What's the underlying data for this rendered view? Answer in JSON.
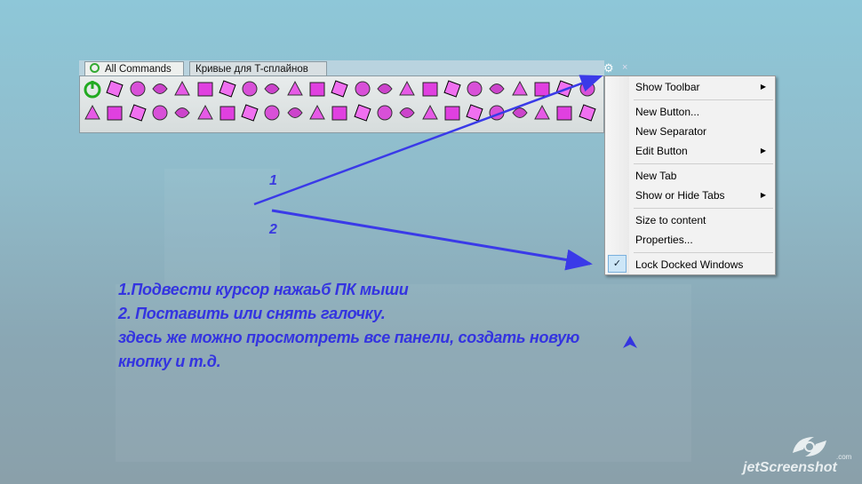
{
  "toolbar": {
    "tabs": [
      {
        "label": "All Commands 00"
      },
      {
        "label": "Кривые для T-сплайнов 01"
      }
    ],
    "gear_icon": "gear-icon",
    "close_glyph": "×",
    "icon_count_per_row": 23,
    "rows": 2
  },
  "context_menu": {
    "items": [
      {
        "label": "Show Toolbar",
        "submenu": true
      },
      {
        "label": "New Button...",
        "submenu": false
      },
      {
        "label": "New Separator",
        "submenu": false
      },
      {
        "label": "Edit Button",
        "submenu": true
      },
      {
        "label": "New Tab",
        "submenu": false
      },
      {
        "label": "Show or Hide Tabs",
        "submenu": true
      },
      {
        "label": "Size to content",
        "submenu": false
      },
      {
        "label": "Properties...",
        "submenu": false
      },
      {
        "label": "Lock Docked Windows",
        "submenu": false,
        "checked": true
      }
    ],
    "check_glyph": "✓",
    "arrow_glyph": "▶"
  },
  "annotations": {
    "label_1": "1",
    "label_2": "2",
    "lines": [
      "1.Подвести курсор нажаьб ПК мыши",
      "2. Поставить или снять галочку.",
      "здесь же можно просмотреть все панели, создать новую",
      "кнопку и т.д."
    ],
    "color": "#3434e0"
  },
  "watermark": {
    "brand": "jetScreenshot",
    "suffix": ".com"
  }
}
